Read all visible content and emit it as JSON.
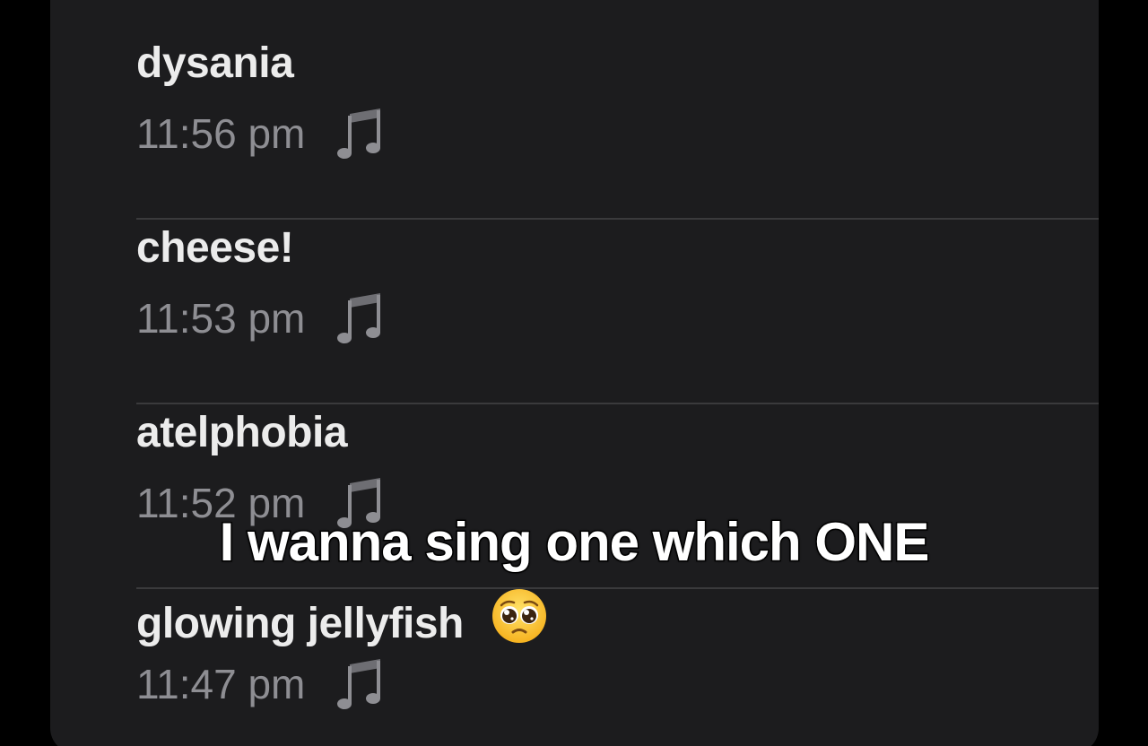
{
  "songs": [
    {
      "title": "dysania",
      "time": "11:56 pm",
      "icon": "music-note-icon"
    },
    {
      "title": "cheese!",
      "time": "11:53 pm",
      "icon": "music-note-icon"
    },
    {
      "title": "atelphobia",
      "time": "11:52 pm",
      "icon": "music-note-icon"
    },
    {
      "title": "glowing jellyfish",
      "emoji": "pleading-face-emoji",
      "time": "11:47 pm",
      "icon": "music-note-icon"
    }
  ],
  "overlay": {
    "caption": "I wanna sing one which ONE"
  },
  "colors": {
    "panel_background": "#1c1c1e",
    "title_text": "#ececec",
    "time_text": "#8e8e93",
    "divider": "#3a3a3c"
  }
}
